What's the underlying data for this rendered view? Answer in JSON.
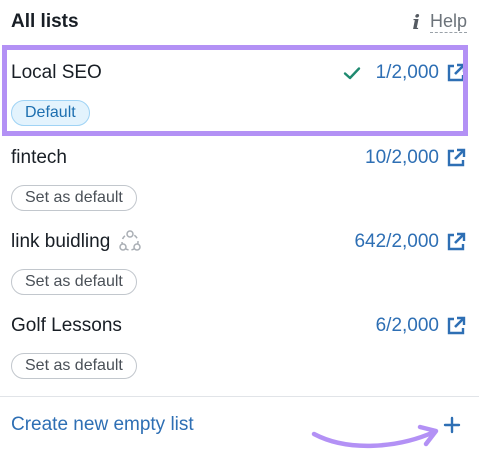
{
  "header": {
    "title": "All lists",
    "help_icon": "i",
    "help_label": "Help"
  },
  "lists": [
    {
      "name": "Local SEO",
      "count": "1/2,000",
      "badge": "Default",
      "is_default": true,
      "selected": true
    },
    {
      "name": "fintech",
      "count": "10/2,000",
      "badge": "Set as default",
      "is_default": false
    },
    {
      "name": "link buidling",
      "count": "642/2,000",
      "badge": "Set as default",
      "is_default": false,
      "shared_icon": "share-network-icon"
    },
    {
      "name": "Golf Lessons",
      "count": "6/2,000",
      "badge": "Set as default",
      "is_default": false
    }
  ],
  "footer": {
    "create_label": "Create new empty list",
    "add_icon": "plus-icon"
  },
  "colors": {
    "accent": "#2e6fb4",
    "highlight": "#b391f5",
    "check": "#1f8a70"
  }
}
